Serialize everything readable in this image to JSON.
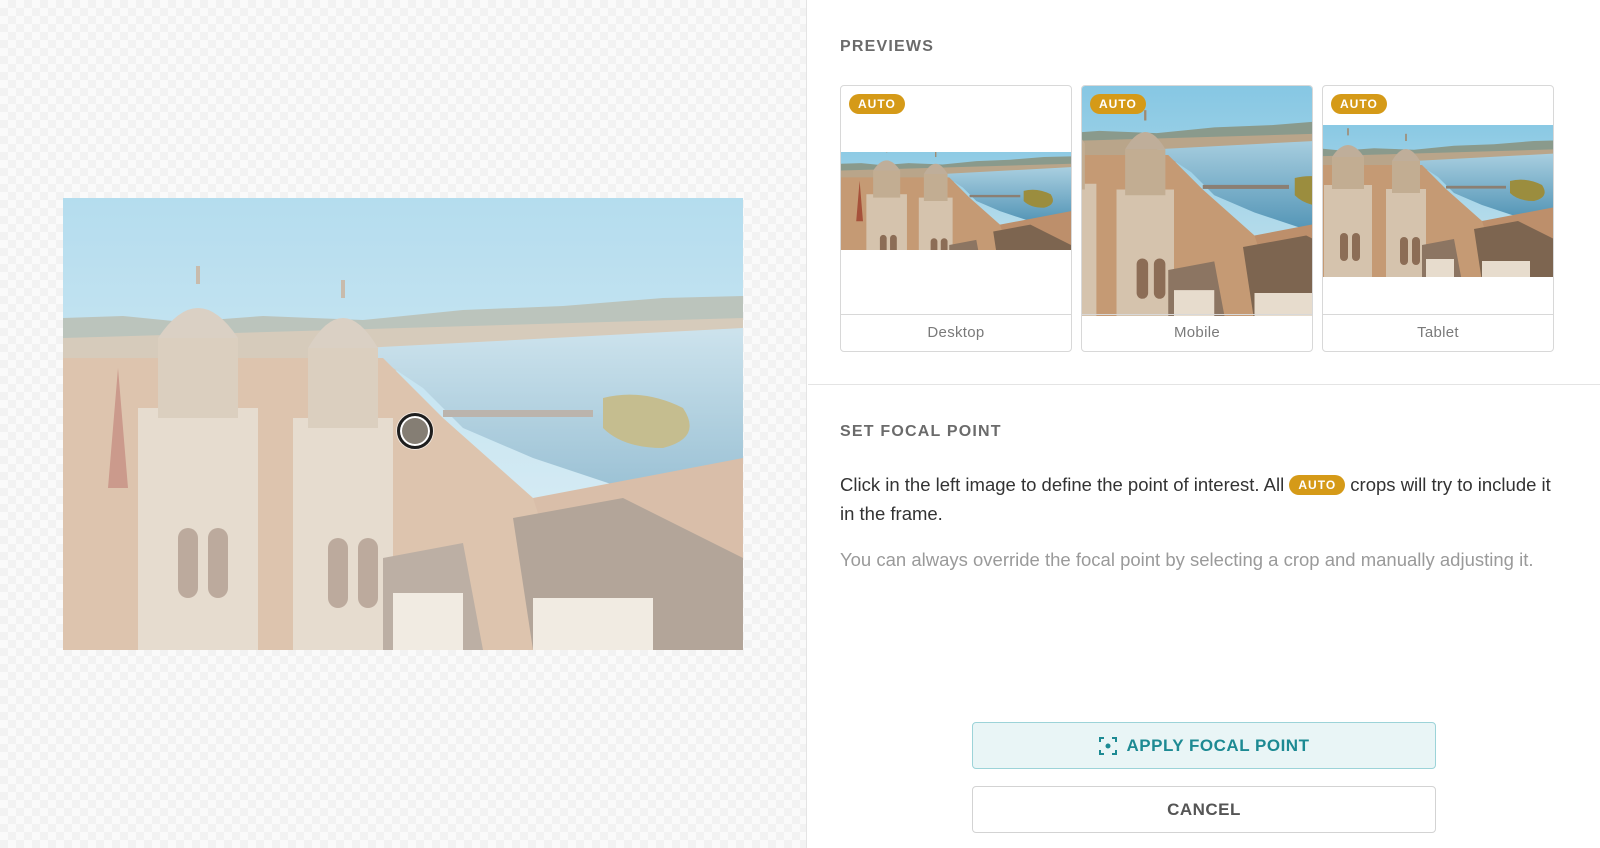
{
  "previews": {
    "title": "PREVIEWS",
    "cards": [
      {
        "label": "Desktop",
        "badge": "AUTO"
      },
      {
        "label": "Mobile",
        "badge": "AUTO"
      },
      {
        "label": "Tablet",
        "badge": "AUTO"
      }
    ]
  },
  "focal": {
    "title": "SET FOCAL POINT",
    "desc_before": "Click in the left image to define the point of interest. All ",
    "desc_badge": "AUTO",
    "desc_after": " crops will try to include it in the frame.",
    "note": "You can always override the focal point by selecting a crop and manually adjusting it."
  },
  "actions": {
    "apply_label": "APPLY FOCAL POINT",
    "apply_icon": "focal-target-icon",
    "cancel_label": "CANCEL"
  },
  "colors": {
    "badge": "#d59a18",
    "accent": "#1d8a93",
    "accent_bg": "#e9f5f6"
  }
}
